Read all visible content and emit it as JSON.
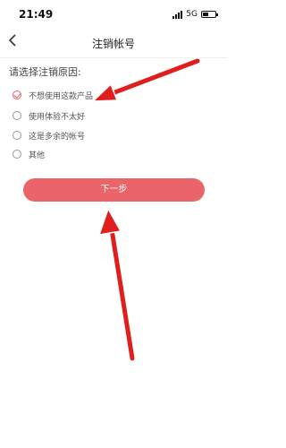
{
  "status_bar": {
    "time": "21:49",
    "network": "5G"
  },
  "nav": {
    "title": "注销帐号"
  },
  "prompt": "请选择注销原因:",
  "options": [
    {
      "label": "不想使用这款产品",
      "checked": true
    },
    {
      "label": "使用体验不太好",
      "checked": false
    },
    {
      "label": "这是多余的帐号",
      "checked": false
    },
    {
      "label": "其他",
      "checked": false
    }
  ],
  "next_button": {
    "label": "下一步"
  },
  "colors": {
    "accent": "#e9656a",
    "annotation_arrow": "#e01e1e"
  }
}
